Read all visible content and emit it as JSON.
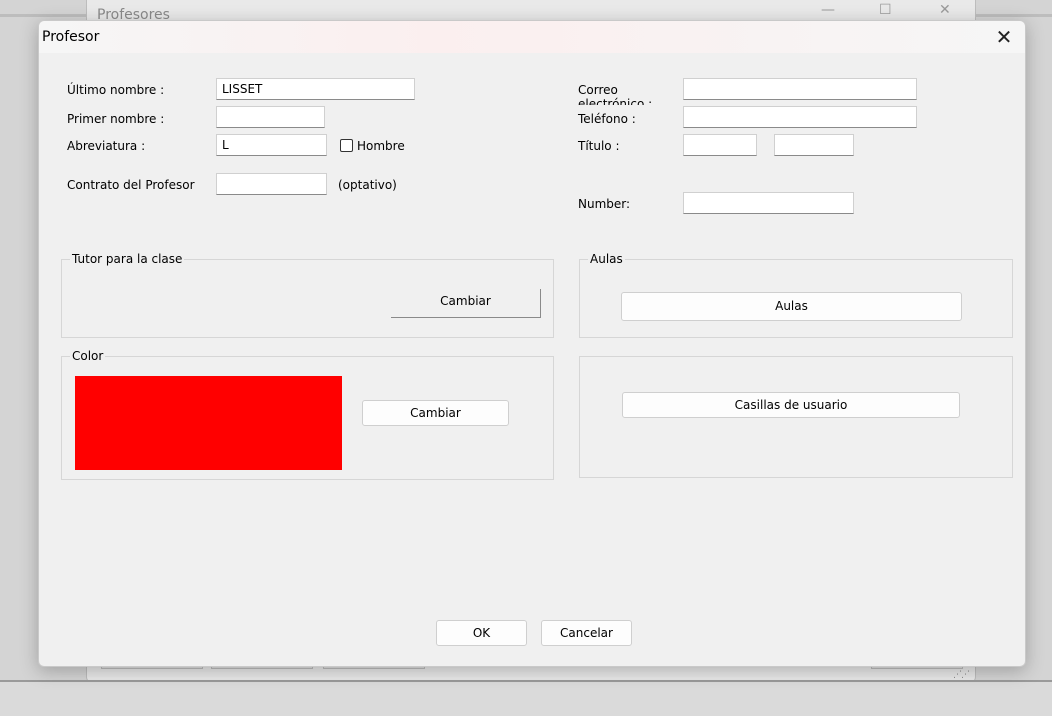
{
  "background_window": {
    "title": "Profesores",
    "minimize_glyph": "—",
    "maximize_glyph": "☐",
    "close_glyph": "✕"
  },
  "dialog": {
    "title": "Profesor",
    "close_glyph": "✕"
  },
  "form": {
    "last_name_label": "Último nombre :",
    "last_name_value": "LISSET",
    "first_name_label": "Primer nombre :",
    "first_name_value": "",
    "abbreviation_label": "Abreviatura :",
    "abbreviation_value": "L",
    "male_checkbox_label": "Hombre",
    "male_checked": false,
    "contract_label": "Contrato del Profesor",
    "contract_value": "",
    "contract_hint": "(optativo)",
    "email_label": "Correo electrónico :",
    "email_value": "",
    "phone_label": "Teléfono :",
    "phone_value": "",
    "title_label": "Título :",
    "title_value_1": "",
    "title_value_2": "",
    "number_label": "Number:",
    "number_value": ""
  },
  "tutor_group": {
    "title": "Tutor para la clase",
    "change_label": "Cambiar"
  },
  "aulas_group": {
    "title": "Aulas",
    "button_label": "Aulas"
  },
  "color_group": {
    "title": "Color",
    "color": "#ff0000",
    "change_label": "Cambiar"
  },
  "user_fields_group": {
    "button_label": "Casillas de usuario"
  },
  "footer": {
    "ok_label": "OK",
    "cancel_label": "Cancelar"
  }
}
